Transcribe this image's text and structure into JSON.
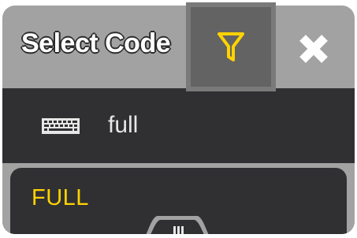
{
  "dialog": {
    "title": "Select Code",
    "filter_icon": "filter-funnel-icon",
    "close_icon": "close-x-icon"
  },
  "input": {
    "icon": "keyboard-icon",
    "value": "full"
  },
  "list": {
    "items": [
      {
        "label": "FULL"
      }
    ]
  },
  "colors": {
    "title_bar": "#a2a2a2",
    "panel": "#303033",
    "accent_yellow": "#ffd200",
    "filter_button": "#636363",
    "text": "#e6e6e6"
  }
}
